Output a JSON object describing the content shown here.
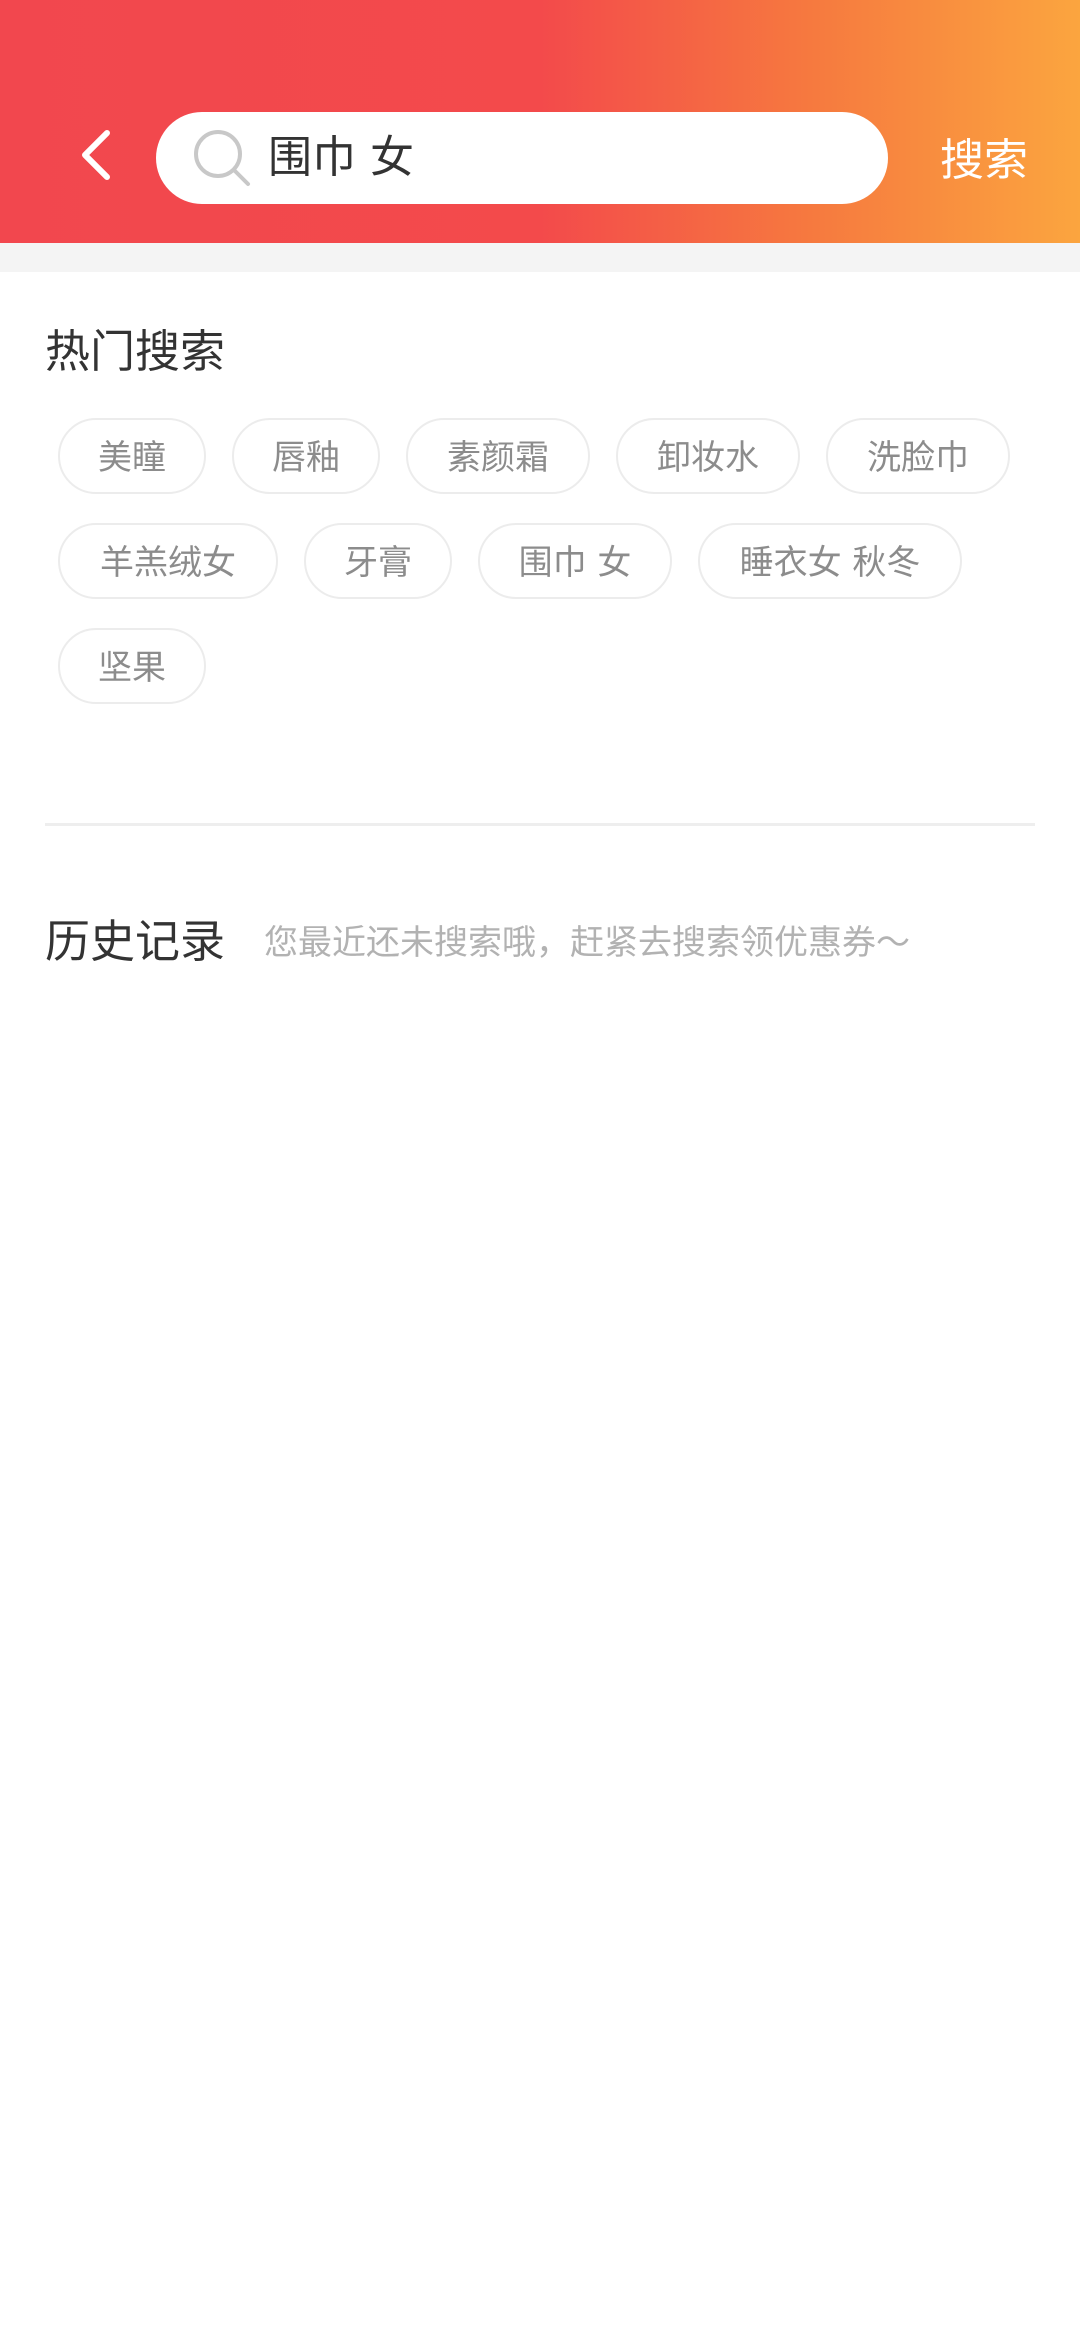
{
  "header": {
    "back_icon": "chevron-left-icon",
    "search_icon": "search-icon",
    "search_value": "围巾 女",
    "search_button_label": "搜索",
    "gradient_colors": [
      "#f2474e",
      "#f34a4b",
      "#f6793f",
      "#fba53f"
    ]
  },
  "hot_search": {
    "title": "热门搜索",
    "tags": [
      {
        "label": "美瞳"
      },
      {
        "label": "唇釉"
      },
      {
        "label": "素颜霜"
      },
      {
        "label": "卸妆水"
      },
      {
        "label": "洗脸巾"
      },
      {
        "label": "羊羔绒女"
      },
      {
        "label": "牙膏"
      },
      {
        "label": "围巾 女"
      },
      {
        "label": "睡衣女 秋冬"
      },
      {
        "label": "坚果"
      }
    ]
  },
  "history": {
    "title": "历史记录",
    "hint": "您最近还未搜索哦，赶紧去搜索领优惠券～"
  }
}
